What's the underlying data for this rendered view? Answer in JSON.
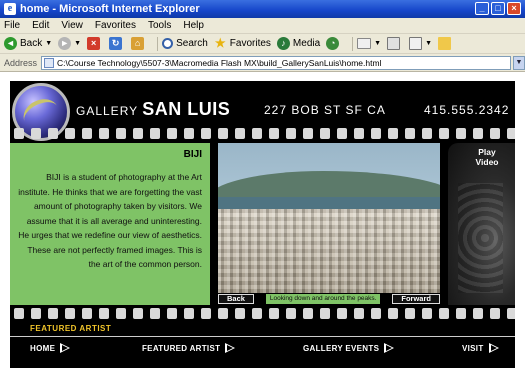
{
  "window": {
    "title": "home - Microsoft Internet Explorer"
  },
  "menu": [
    "File",
    "Edit",
    "View",
    "Favorites",
    "Tools",
    "Help"
  ],
  "toolbar": {
    "back": "Back",
    "search": "Search",
    "favorites": "Favorites",
    "media": "Media"
  },
  "address": {
    "label": "Address",
    "url": "C:\\Course Technology\\5507-3\\Macromedia Flash MX\\build_GallerySanLuis\\home.html"
  },
  "site": {
    "gallery_prefix": "GALLERY",
    "gallery_name": "SAN LUIS",
    "street": "227 BOB ST  SF CA",
    "phone": "415.555.2342",
    "artist_name": "BIJI",
    "artist_bio": "BIJI is a student of photography at the Art institute. He thinks that we are forgetting the vast amount of photography taken by visitors. We assume that it is all average and uninteresting. He urges that we redefine our view of aesthetics. These are not perfectly framed images. This is the art of the common person.",
    "back_button": "Back",
    "caption": "Looking down and around the peaks.",
    "forward_button": "Forward",
    "play_video_line1": "Play",
    "play_video_line2": "Video",
    "featured_label": "FEATURED ARTIST",
    "nav": [
      {
        "label": "HOME"
      },
      {
        "label": "FEATURED ARTIST"
      },
      {
        "label": "GALLERY EVENTS"
      },
      {
        "label": "VISIT"
      }
    ]
  },
  "colors": {
    "accent_green": "#7fc366",
    "featured_yellow": "#f0c42a",
    "background": "#000000"
  },
  "icons": [
    "ie-icon",
    "back-icon",
    "forward-icon",
    "stop-icon",
    "refresh-icon",
    "home-icon",
    "search-icon",
    "favorites-icon",
    "media-icon",
    "history-icon",
    "mail-icon",
    "print-icon",
    "edit-icon",
    "folder-icon"
  ]
}
